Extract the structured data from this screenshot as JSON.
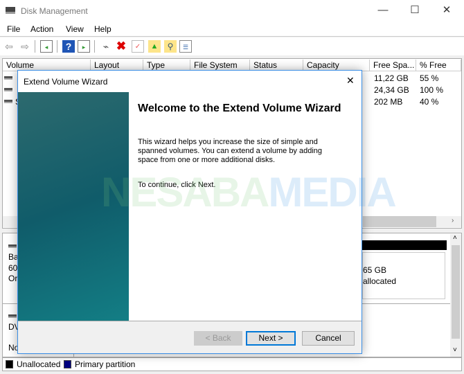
{
  "window": {
    "title": "Disk Management",
    "minimize": "—",
    "maximize": "☐",
    "close": "✕"
  },
  "menu": [
    "File",
    "Action",
    "View",
    "Help"
  ],
  "toolbar": [
    "back-icon",
    "forward-icon",
    "console-tree-icon",
    "help-icon",
    "action-pane-icon",
    "connect-icon",
    "delete-icon",
    "properties-icon",
    "folder-up-icon",
    "search-icon",
    "checklist-icon"
  ],
  "columns": [
    "Volume",
    "Layout",
    "Type",
    "File System",
    "Status",
    "Capacity",
    "Free Spa...",
    "% Free"
  ],
  "rows": [
    {
      "volume": "",
      "free": "11,22 GB",
      "pct": "55 %"
    },
    {
      "volume": "",
      "free": "24,34 GB",
      "pct": "100 %"
    },
    {
      "volume": "S",
      "free": "202 MB",
      "pct": "40 %"
    }
  ],
  "disks": [
    {
      "lines": [
        "Ba",
        "60,",
        "Or"
      ]
    },
    {
      "lines": [
        "DV",
        "",
        "No"
      ]
    }
  ],
  "partition": {
    "size": "65 GB",
    "status": "allocated"
  },
  "legend": [
    {
      "label": "Unallocated",
      "color": "#000000"
    },
    {
      "label": "Primary partition",
      "color": "#000080"
    }
  ],
  "dialog": {
    "title": "Extend Volume Wizard",
    "close": "✕",
    "heading": "Welcome to the Extend Volume Wizard",
    "body": "This wizard helps you increase the size of simple and spanned volumes. You can extend a volume  by adding space from one or more additional disks.",
    "cont": "To continue, click Next.",
    "back": "< Back",
    "next": "Next >",
    "cancel": "Cancel"
  },
  "watermark": "NESABAMEDIA",
  "colors": {
    "accent": "#0078d7",
    "teal": "#105c6a"
  }
}
